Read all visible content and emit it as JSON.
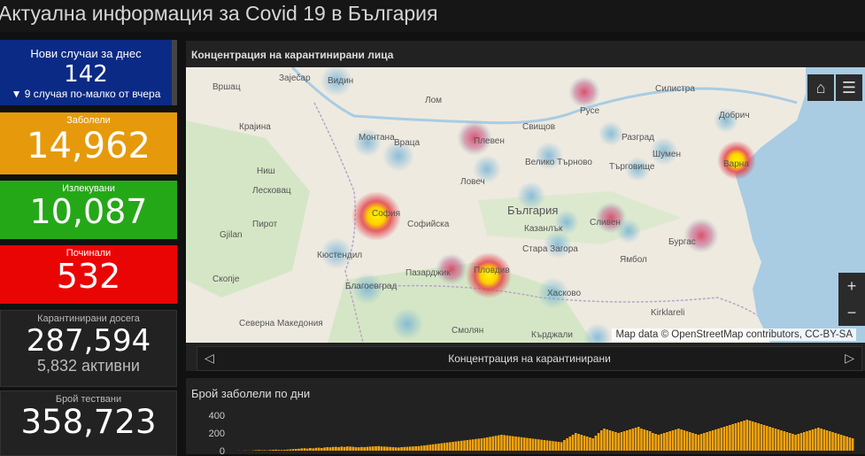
{
  "header": {
    "title": "Актуална информация за Covid 19 в България"
  },
  "cards": {
    "new_cases": {
      "label": "Нови случаи за днес",
      "value": "142",
      "change": "▼ 9 случая по-малко от вчера"
    },
    "infected": {
      "label": "Заболели",
      "value": "14,962"
    },
    "recovered": {
      "label": "Излекувани",
      "value": "10,087"
    },
    "deceased": {
      "label": "Починали",
      "value": "532"
    },
    "quarantined": {
      "label": "Карантинирани досега",
      "value": "287,594",
      "active": "5,832 активни"
    },
    "tests": {
      "label": "Брой тествани",
      "value": "358,723"
    }
  },
  "map_panel": {
    "title": "Концентрация на карантинирани лица",
    "attribution": "Map data © OpenStreetMap contributors, CC-BY-SA",
    "pager_label": "Концентрация на карантинирани",
    "labels": [
      "Заječар",
      "Видин",
      "Вршац",
      "Крајина",
      "Лом",
      "Враца",
      "Монтана",
      "Плевен",
      "Ловеч",
      "Свищов",
      "Русе",
      "Силистра",
      "Разград",
      "Велико Търново",
      "Търговище",
      "Шумен",
      "Добрич",
      "Варна",
      "Ниш",
      "Лесковац",
      "Пирот",
      "София",
      "Софийска",
      "Пловдив",
      "Пазарджик",
      "Кюстендил",
      "Благоевград",
      "Стара Загора",
      "Казанлък",
      "Сливен",
      "Ямбол",
      "Бургас",
      "Хасково",
      "Кърджали",
      "Смолян",
      "Скопје",
      "Северна Македония",
      "Kirklareli",
      "Gjilan",
      "България"
    ],
    "map_colors": {
      "land": "#eeeae0",
      "water": "#a9cce3",
      "forest": "#cfe3c1",
      "heat_high": "#ffe900",
      "heat_mid": "#e23b46",
      "heat_low": "#7bb9d9"
    }
  },
  "cases_chart": {
    "title": "Брой заболели по дни",
    "chart_data": {
      "type": "bar",
      "title": "Брой заболели по дни",
      "ylim": [
        0,
        400
      ],
      "yticks": [
        "400",
        "200",
        "0"
      ],
      "bar_color": "#f2a30f",
      "values": [
        0,
        0,
        1,
        0,
        2,
        1,
        1,
        3,
        6,
        8,
        5,
        6,
        4,
        8,
        10,
        12,
        9,
        8,
        10,
        12,
        15,
        18,
        20,
        22,
        26,
        28,
        24,
        30,
        26,
        32,
        34,
        30,
        36,
        40,
        38,
        42,
        44,
        40,
        46,
        42,
        48,
        46,
        44,
        40,
        38,
        42,
        40,
        44,
        46,
        48,
        50,
        52,
        48,
        46,
        44,
        42,
        40,
        38,
        36,
        40,
        42,
        44,
        46,
        48,
        50,
        52,
        56,
        60,
        64,
        68,
        72,
        76,
        80,
        84,
        88,
        92,
        96,
        100,
        104,
        108,
        112,
        116,
        120,
        124,
        128,
        132,
        136,
        140,
        144,
        150,
        156,
        162,
        168,
        174,
        180,
        176,
        172,
        168,
        164,
        160,
        156,
        152,
        148,
        144,
        140,
        136,
        132,
        128,
        124,
        120,
        116,
        112,
        108,
        104,
        100,
        96,
        120,
        140,
        160,
        180,
        200,
        190,
        180,
        170,
        160,
        150,
        140,
        170,
        200,
        230,
        250,
        240,
        230,
        220,
        210,
        200,
        210,
        220,
        230,
        240,
        250,
        260,
        270,
        250,
        240,
        230,
        220,
        200,
        190,
        180,
        190,
        200,
        210,
        220,
        230,
        240,
        250,
        240,
        230,
        220,
        210,
        200,
        190,
        180,
        190,
        200,
        210,
        220,
        230,
        240,
        250,
        260,
        270,
        280,
        290,
        300,
        310,
        320,
        330,
        340,
        350,
        340,
        330,
        320,
        310,
        300,
        290,
        280,
        270,
        260,
        250,
        240,
        230,
        220,
        210,
        200,
        190,
        180,
        190,
        200,
        210,
        220,
        230,
        240,
        250,
        260,
        250,
        240,
        230,
        220,
        210,
        200,
        190,
        180,
        170,
        160,
        150,
        140
      ]
    }
  }
}
